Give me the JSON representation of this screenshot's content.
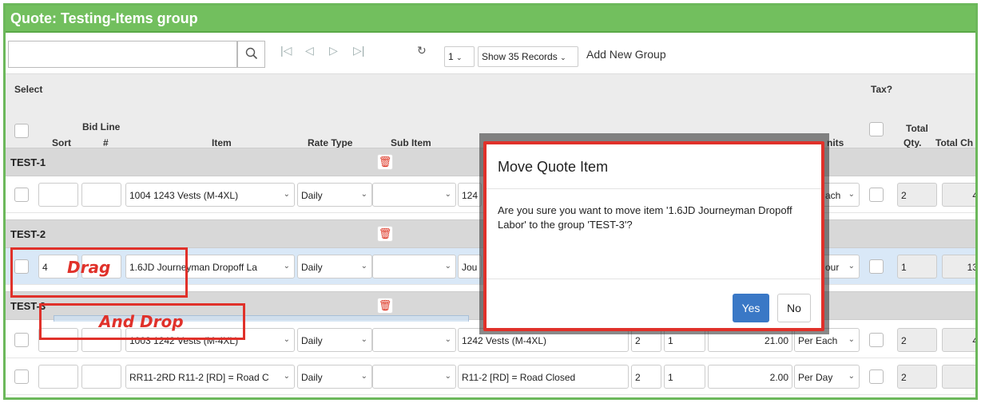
{
  "window": {
    "title": "Quote: Testing-Items group"
  },
  "toolbar": {
    "search_placeholder": "",
    "page_value": "1",
    "records_label": "Show 35 Records",
    "add_group": "Add New Group"
  },
  "header": {
    "select": "Select",
    "tax": "Tax?",
    "sort": "Sort",
    "bid_line": "Bid Line",
    "bid_line_hash": "#",
    "item": "Item",
    "rate_type": "Rate Type",
    "sub_item": "Sub Item",
    "units": "nits",
    "total": "Total",
    "qty": "Qty.",
    "total_ch": "Total Ch"
  },
  "groups": [
    {
      "label": "TEST-1"
    },
    {
      "label": "TEST-2"
    },
    {
      "label": "TEST-3"
    }
  ],
  "rows": [
    {
      "sort": "",
      "bid": "",
      "item": "1004      1243 Vests (M-4XL)",
      "rate": "Daily",
      "sub": "",
      "desc": "124",
      "units": "ach",
      "qty": "2",
      "total": "4"
    },
    {
      "sort": "4",
      "bid": "",
      "item": "1.6JD      Journeyman Dropoff La",
      "rate": "Daily",
      "sub": "",
      "desc": "Jou",
      "units": "our",
      "qty": "1",
      "total": "13"
    },
    {
      "sort": "",
      "bid": "",
      "item": "1003      1242 Vests (M-4XL)",
      "rate": "Daily",
      "sub": "",
      "desc": "1242 Vests (M-4XL)",
      "a": "2",
      "b": "1",
      "price": "21.00",
      "units": "Per Each",
      "qty": "2",
      "total": "4"
    },
    {
      "sort": "",
      "bid": "",
      "item": "RR11-2RD   R11-2 [RD] = Road C",
      "rate": "Daily",
      "sub": "",
      "desc": "R11-2 [RD] = Road Closed",
      "a": "2",
      "b": "1",
      "price": "2.00",
      "units": "Per Day",
      "qty": "2",
      "total": ""
    }
  ],
  "annotations": {
    "drag": "Drag",
    "drop": "And Drop"
  },
  "modal": {
    "title": "Move Quote Item",
    "body": "Are you sure you want to move item '1.6JD       Journeyman Dropoff Labor' to the group 'TEST-3'?",
    "yes": "Yes",
    "no": "No"
  },
  "colors": {
    "title_bar": "#72bf5e",
    "highlight": "#e0312a",
    "primary": "#3a78c6"
  }
}
